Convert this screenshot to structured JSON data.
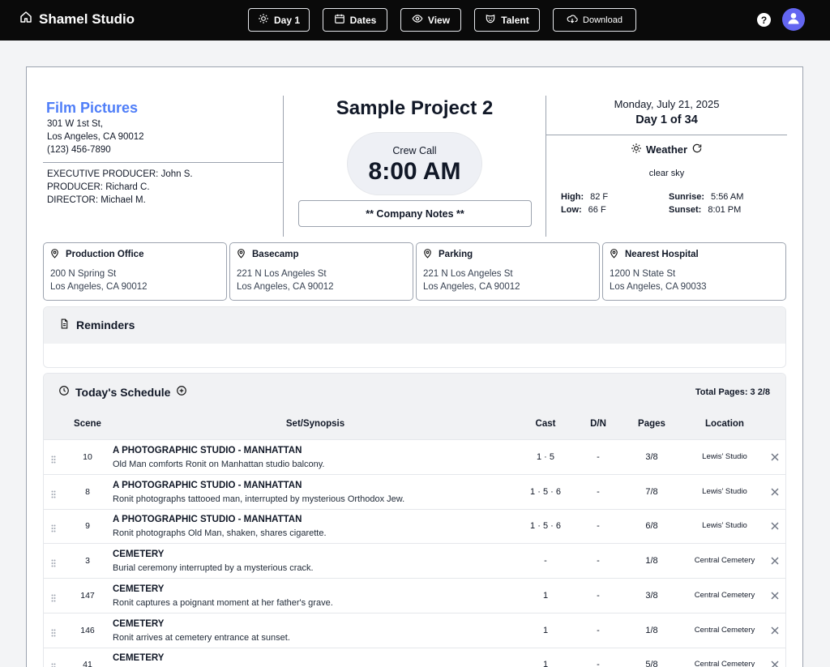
{
  "app": {
    "name": "Shamel Studio"
  },
  "nav": {
    "day": "Day 1",
    "dates": "Dates",
    "view": "View",
    "talent": "Talent",
    "download": "Download",
    "help": "?"
  },
  "company": {
    "name": "Film Pictures",
    "address1": "301 W 1st St,",
    "address2": "Los Angeles, CA 90012",
    "phone": "(123) 456-7890",
    "executive_producer": "EXECUTIVE PRODUCER: John S.",
    "producer": "PRODUCER: Richard C.",
    "director": "DIRECTOR: Michael M."
  },
  "project": {
    "title": "Sample Project 2",
    "crew_call_label": "Crew Call",
    "crew_call_time": "8:00 AM",
    "company_notes": "** Company Notes **"
  },
  "day_info": {
    "date": "Monday, July 21, 2025",
    "day_count": "Day 1 of 34"
  },
  "weather": {
    "title": "Weather",
    "description": "clear sky",
    "high_label": "High:",
    "high": "82 F",
    "low_label": "Low:",
    "low": "66 F",
    "sunrise_label": "Sunrise:",
    "sunrise": "5:56 AM",
    "sunset_label": "Sunset:",
    "sunset": "8:01 PM"
  },
  "locations": [
    {
      "title": "Production Office",
      "line1": "200 N Spring St",
      "line2": "Los Angeles, CA 90012"
    },
    {
      "title": "Basecamp",
      "line1": "221 N Los Angeles St",
      "line2": "Los Angeles, CA 90012"
    },
    {
      "title": "Parking",
      "line1": "221 N Los Angeles St",
      "line2": "Los Angeles, CA 90012"
    },
    {
      "title": "Nearest Hospital",
      "line1": "1200 N State St",
      "line2": "Los Angeles, CA 90033"
    }
  ],
  "reminders": {
    "title": "Reminders"
  },
  "schedule": {
    "title": "Today's Schedule",
    "total_pages": "Total Pages: 3 2/8",
    "columns": {
      "scene": "Scene",
      "set": "Set/Synopsis",
      "cast": "Cast",
      "dn": "D/N",
      "pages": "Pages",
      "location": "Location"
    },
    "rows": [
      {
        "scene": "10",
        "set": "A PHOTOGRAPHIC STUDIO - MANHATTAN",
        "synopsis": "Old Man comforts Ronit on Manhattan studio balcony.",
        "cast": "1 · 5",
        "dn": "-",
        "pages": "3/8",
        "location": "Lewis' Studio"
      },
      {
        "scene": "8",
        "set": "A PHOTOGRAPHIC STUDIO - MANHATTAN",
        "synopsis": "Ronit photographs tattooed man, interrupted by mysterious Orthodox Jew.",
        "cast": "1 · 5 · 6",
        "dn": "-",
        "pages": "7/8",
        "location": "Lewis' Studio"
      },
      {
        "scene": "9",
        "set": "A PHOTOGRAPHIC STUDIO - MANHATTAN",
        "synopsis": "Ronit photographs Old Man, shaken, shares cigarette.",
        "cast": "1 · 5 · 6",
        "dn": "-",
        "pages": "6/8",
        "location": "Lewis' Studio"
      },
      {
        "scene": "3",
        "set": "CEMETERY",
        "synopsis": "Burial ceremony interrupted by a mysterious crack.",
        "cast": "-",
        "dn": "-",
        "pages": "1/8",
        "location": "Central Cemetery"
      },
      {
        "scene": "147",
        "set": "CEMETERY",
        "synopsis": "Ronit captures a poignant moment at her father's grave.",
        "cast": "1",
        "dn": "-",
        "pages": "3/8",
        "location": "Central Cemetery"
      },
      {
        "scene": "146",
        "set": "CEMETERY",
        "synopsis": "Ronit arrives at cemetery entrance at sunset.",
        "cast": "1",
        "dn": "-",
        "pages": "1/8",
        "location": "Central Cemetery"
      },
      {
        "scene": "41",
        "set": "CEMETERY",
        "synopsis": "",
        "cast": "1",
        "dn": "-",
        "pages": "5/8",
        "location": "Central Cemetery"
      }
    ]
  }
}
